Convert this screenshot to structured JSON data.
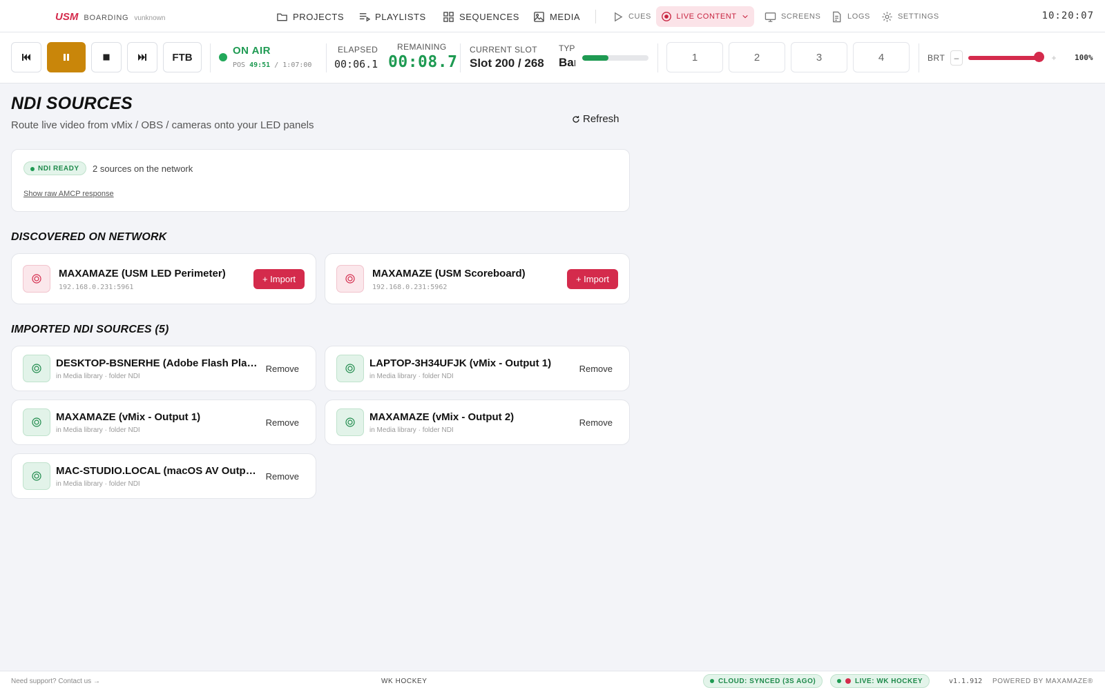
{
  "brand": {
    "logo": "USM",
    "name": "BOARDING",
    "user": "vunknown"
  },
  "nav": {
    "projects": "PROJECTS",
    "playlists": "PLAYLISTS",
    "sequences": "SEQUENCES",
    "media": "MEDIA",
    "cues": "CUES",
    "live_content": "LIVE CONTENT",
    "screens": "SCREENS",
    "logs": "LOGS",
    "settings": "SETTINGS"
  },
  "clock": "10:20:07",
  "transport": {
    "ftb_label": "FTB",
    "status": "ON AIR",
    "pos_label": "POS",
    "pos_value": "49:51",
    "pos_total": "/ 1:07:00",
    "elapsed_label": "ELAPSED",
    "elapsed_value": "00:06.1",
    "remaining_label": "REMAINING",
    "remaining_value": "00:08.7",
    "slot_label": "CURRENT SLOT",
    "slot_value": "Slot 200 / 268",
    "type_label": "TYPE",
    "type_value": "Banner",
    "slot_progress": 0.4,
    "presets": [
      "1",
      "2",
      "3",
      "4"
    ],
    "brt_label": "BRT",
    "brt_minus": "–",
    "brt_plus": "+",
    "brt_value": "100%",
    "brt_level": 1.0
  },
  "page": {
    "title": "NDI SOURCES",
    "subtitle": "Route live video from vMix / OBS / cameras onto your LED panels",
    "refresh_label": "Refresh"
  },
  "status": {
    "badge": "NDI READY",
    "count_text": "2 sources on the network",
    "raw_link": "Show raw AMCP response"
  },
  "discovered": {
    "title": "DISCOVERED ON NETWORK",
    "import_label": "+ Import",
    "items": [
      {
        "name": "MAXAMAZE (USM LED Perimeter)",
        "address": "192.168.0.231:5961"
      },
      {
        "name": "MAXAMAZE (USM Scoreboard)",
        "address": "192.168.0.231:5962"
      }
    ]
  },
  "imported": {
    "title": "IMPORTED NDI SOURCES (5)",
    "remove_label": "Remove",
    "items": [
      {
        "name": "DESKTOP-BSNERHE (Adobe Flash Player)",
        "meta": "in Media library · folder NDI"
      },
      {
        "name": "LAPTOP-3H34UFJK (vMix - Output 1)",
        "meta": "in Media library · folder NDI"
      },
      {
        "name": "MAXAMAZE (vMix - Output 1)",
        "meta": "in Media library · folder NDI"
      },
      {
        "name": "MAXAMAZE (vMix - Output 2)",
        "meta": "in Media library · folder NDI"
      },
      {
        "name": "MAC-STUDIO.LOCAL (macOS AV Output)",
        "meta": "in Media library · folder NDI"
      }
    ]
  },
  "footer": {
    "support": "Need support? Contact us →",
    "project": "WK HOCKEY",
    "cloud": "CLOUD: SYNCED (3S AGO)",
    "live": "LIVE: WK HOCKEY",
    "version": "v1.1.912",
    "powered": "POWERED BY MAXAMAZE®"
  },
  "colors": {
    "accent": "#d42b4c",
    "on_air": "#1e9a52",
    "pause_active": "#c9860a"
  }
}
